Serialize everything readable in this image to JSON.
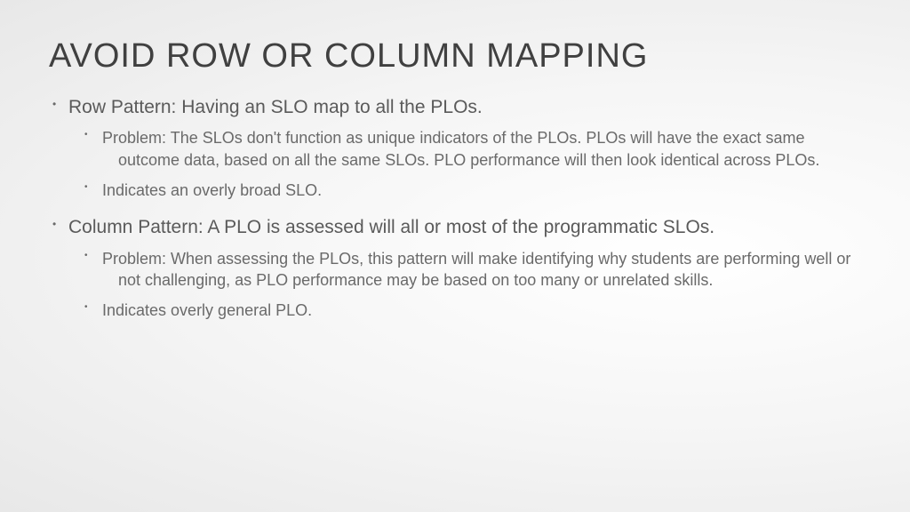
{
  "title": "AVOID ROW OR COLUMN MAPPING",
  "bullets": [
    {
      "text": "Row Pattern: Having an SLO map to all the PLOs.",
      "sub": [
        "Problem: The SLOs don't function as unique indicators of the PLOs. PLOs will have the exact same outcome data, based on all the same SLOs. PLO performance will then look identical across PLOs.",
        "Indicates an overly broad SLO."
      ]
    },
    {
      "text": "Column Pattern: A PLO is assessed will all or most of the programmatic SLOs.",
      "sub": [
        "Problem: When assessing the PLOs, this pattern will make identifying why students are performing well or not challenging, as PLO performance may be based on too many or unrelated skills.",
        "Indicates overly general PLO."
      ]
    }
  ]
}
